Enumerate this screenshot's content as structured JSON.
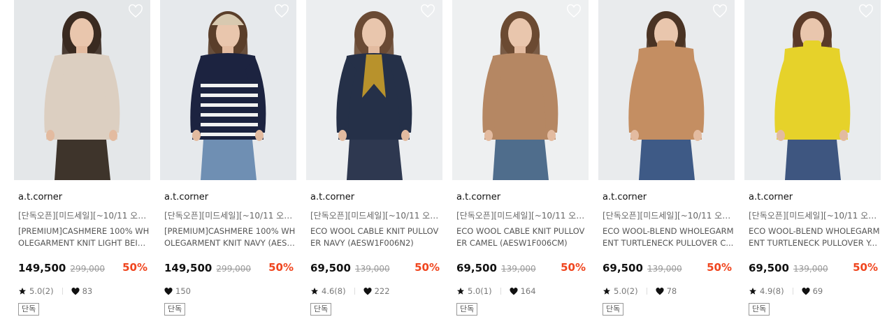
{
  "products": [
    {
      "brand": "a.t.corner",
      "promo": "[단독오픈][미드세일][~10/11 오전 10...",
      "name": "[PREMIUM]CASHMERE 100% WHOLEGARMENT KNIT LIGHT BEIGE (...",
      "price": "149,500",
      "original_price": "299,000",
      "discount": "50%",
      "rating": "5.0(2)",
      "likes": "83",
      "badge": "단독",
      "colors": {
        "bg": "#e4e7e9",
        "garment": "#dccfc1",
        "bottom": "#3e342b",
        "hair": "#3a2a20"
      }
    },
    {
      "brand": "a.t.corner",
      "promo": "[단독오픈][미드세일][~10/11 오전 10...",
      "name": "[PREMIUM]CASHMERE 100% WHOLEGARMENT KNIT NAVY (AESW1...",
      "price": "149,500",
      "original_price": "299,000",
      "discount": "50%",
      "rating": "",
      "likes": "150",
      "badge": "단독",
      "colors": {
        "bg": "#e6e9ec",
        "garment": "#1c2340",
        "bottom": "#6f8fb3",
        "hair": "#5a3e2a"
      }
    },
    {
      "brand": "a.t.corner",
      "promo": "[단독오픈][미드세일][~10/11 오전 10...",
      "name": "ECO WOOL CABLE KNIT PULLOVER NAVY (AESW1F006N2)",
      "price": "69,500",
      "original_price": "139,000",
      "discount": "50%",
      "rating": "4.6(8)",
      "likes": "222",
      "badge": "단독",
      "colors": {
        "bg": "#eceef0",
        "garment": "#253048",
        "bottom": "#2e3850",
        "hair": "#6a4a34"
      }
    },
    {
      "brand": "a.t.corner",
      "promo": "[단독오픈][미드세일][~10/11 오전 10...",
      "name": "ECO WOOL CABLE KNIT PULLOVER CAMEL (AESW1F006CM)",
      "price": "69,500",
      "original_price": "139,000",
      "discount": "50%",
      "rating": "5.0(1)",
      "likes": "164",
      "badge": "단독",
      "colors": {
        "bg": "#eef0f1",
        "garment": "#b58763",
        "bottom": "#4f6d8c",
        "hair": "#6b4a32"
      }
    },
    {
      "brand": "a.t.corner",
      "promo": "[단독오픈][미드세일][~10/11 오전 10...",
      "name": "ECO WOOL-BLEND WHOLEGARMENT TURTLENECK PULLOVER C...",
      "price": "69,500",
      "original_price": "139,000",
      "discount": "50%",
      "rating": "5.0(2)",
      "likes": "78",
      "badge": "단독",
      "colors": {
        "bg": "#e9ebed",
        "garment": "#c48e62",
        "bottom": "#3e5a86",
        "hair": "#4a3324"
      }
    },
    {
      "brand": "a.t.corner",
      "promo": "[단독오픈][미드세일][~10/11 오전 10...",
      "name": "ECO WOOL-BLEND WHOLEGARMENT TURTLENECK PULLOVER Y...",
      "price": "69,500",
      "original_price": "139,000",
      "discount": "50%",
      "rating": "4.9(8)",
      "likes": "69",
      "badge": "단독",
      "colors": {
        "bg": "#e9ecee",
        "garment": "#e6d22a",
        "bottom": "#3e5680",
        "hair": "#5a3a28"
      }
    }
  ],
  "icons": {
    "wishlist": "heart-outline-icon",
    "rating": "star-icon",
    "likes": "heart-icon"
  },
  "accent": {
    "discount": "#f0451e"
  }
}
